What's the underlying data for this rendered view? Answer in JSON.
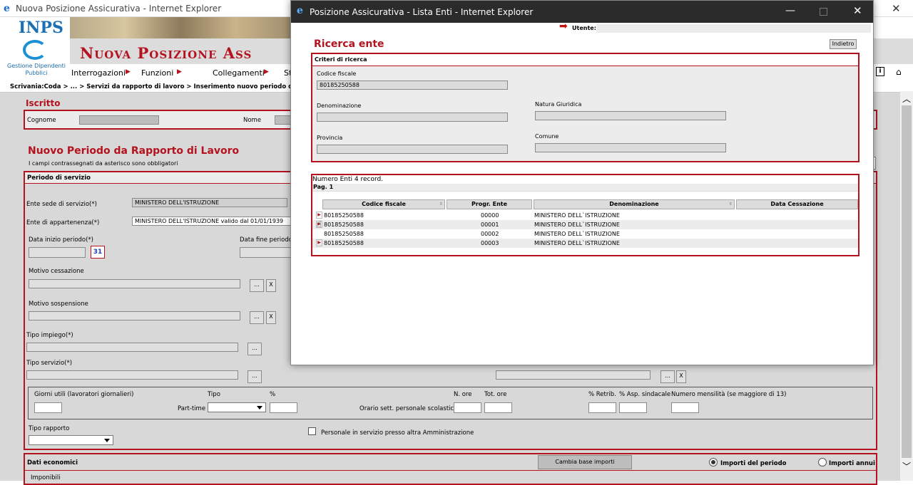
{
  "main_window": {
    "title": "Nuova Posizione Assicurativa - Internet Explorer",
    "logo_text": "INPS",
    "logo_sub": "Gestione Dipendenti Pubblici",
    "banner_title": "Nuova Posizione Ass",
    "menu": [
      "Interrogazioni",
      "Funzioni",
      "Collegamenti",
      "St"
    ],
    "breadcrumb": "Scrivania:Coda > ... > Servizi da rapporto di lavoro > Inserimento nuovo periodo da rapp"
  },
  "iscritto": {
    "title": "Iscritto",
    "cognome_label": "Cognome",
    "nome_label": "Nome"
  },
  "periodo": {
    "title": "Nuovo Periodo da Rapporto di Lavoro",
    "note": "I campi contrassegnati da asterisco sono obbligatori",
    "section": "Periodo di servizio",
    "ente_sede_label": "Ente sede di servizio(*)",
    "ente_sede_value": "MINISTERO DELL'ISTRUZIONE",
    "ente_app_label": "Ente di appartenenza(*)",
    "ente_app_value": "MINISTERO DELL'ISTRUZIONE valido dal 01/01/1939",
    "data_inizio_label": "Data inizio periodo(*)",
    "data_fine_label": "Data fine periodo",
    "calendar_num": "31",
    "motivo_cessazione": "Motivo cessazione",
    "motivo_sospensione": "Motivo sospensione",
    "tipo_impiego": "Tipo impiego(*)",
    "tipo_servizio": "Tipo servizio(*)",
    "dots": "...",
    "x": "X",
    "giorni": "Giorni utili (lavoratori giornalieri)",
    "tipo": "Tipo",
    "perc": "%",
    "part_time": "Part-time",
    "orario": "Orario sett. personale scolastico",
    "n_ore": "N. ore",
    "tot_ore": "Tot. ore",
    "retrib": "% Retrib.",
    "asp": "% Asp. sindacale",
    "mensilita": "Numero mensilità (se maggiore di 13)",
    "tipo_rapporto": "Tipo rapporto",
    "personale": "Personale in servizio presso altra Amministrazione",
    "dati_economici": "Dati economici",
    "cambia": "Cambia base importi",
    "importi_periodo": "Importi del periodo",
    "importi_annui": "Importi annui",
    "imponibili": "Imponibili"
  },
  "popup": {
    "title": "Posizione Assicurativa - Lista Enti - Internet Explorer",
    "utente_label": "Utente:",
    "heading": "Ricerca ente",
    "back": "Indietro",
    "criteri": "Criteri di ricerca",
    "codice_fiscale_label": "Codice fiscale",
    "codice_fiscale_value": "80185250588",
    "denominazione_label": "Denominazione",
    "natura_label": "Natura Giuridica",
    "provincia_label": "Provincia",
    "comune_label": "Comune",
    "records": "Numero Enti 4 record.",
    "pag": "Pag. 1",
    "columns": [
      "Codice fiscale",
      "Progr. Ente",
      "Denominazione",
      "Data Cessazione"
    ],
    "rows": [
      {
        "cf": "80185250588",
        "progr": "00000",
        "den": "MINISTERO DELL`ISTRUZIONE",
        "data": ""
      },
      {
        "cf": "80185250588",
        "progr": "00001",
        "den": "MINISTERO DELL`ISTRUZIONE",
        "data": ""
      },
      {
        "cf": "80185250588",
        "progr": "00002",
        "den": "MINISTERO DELL`ISTRUZIONE",
        "data": ""
      },
      {
        "cf": "80185250588",
        "progr": "00003",
        "den": "MINISTERO DELL`ISTRUZIONE",
        "data": ""
      }
    ]
  },
  "colors": {
    "accent": "#b3121e",
    "panel": "#ececec",
    "header_bg": "#dcdcdc"
  }
}
